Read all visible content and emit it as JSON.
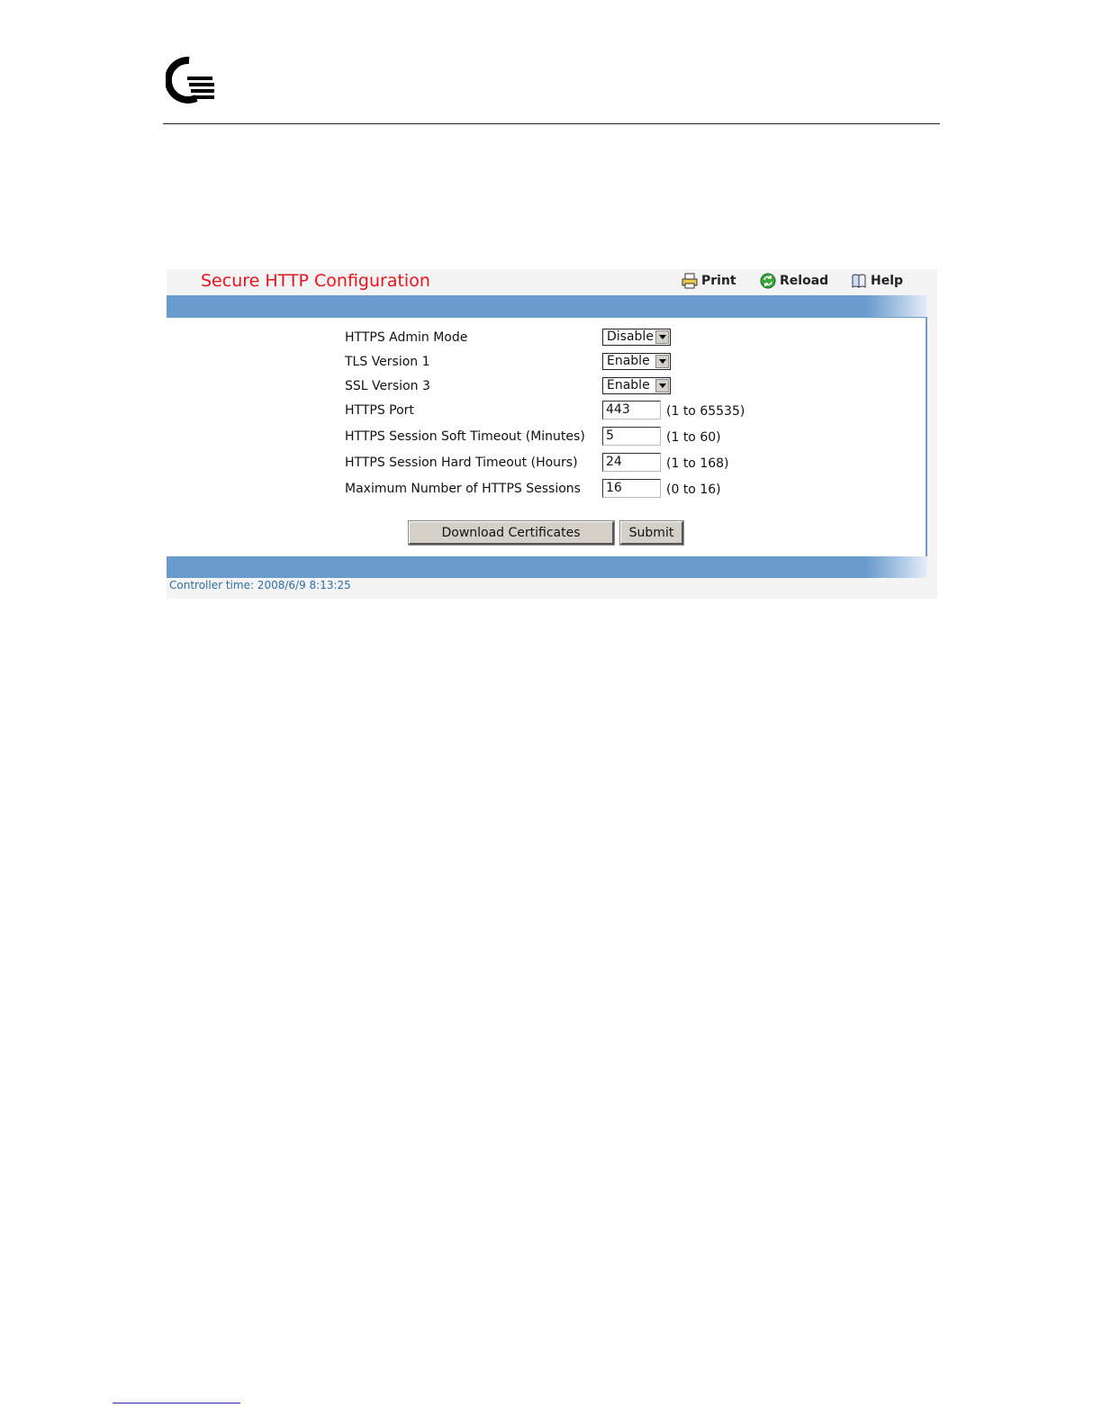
{
  "panel": {
    "title": "Secure HTTP Configuration",
    "toolbar": {
      "print_label": "Print",
      "reload_label": "Reload",
      "help_label": "Help",
      "icons": [
        "printer-icon",
        "reload-icon",
        "help-book-icon"
      ]
    }
  },
  "form": {
    "https_admin_mode": {
      "label": "HTTPS Admin Mode",
      "value": "Disable"
    },
    "tls_version_1": {
      "label": "TLS Version 1",
      "value": "Enable"
    },
    "ssl_version_3": {
      "label": "SSL Version 3",
      "value": "Enable"
    },
    "https_port": {
      "label": "HTTPS Port",
      "value": "443",
      "range": "(1 to 65535)"
    },
    "soft_timeout": {
      "label": "HTTPS Session Soft Timeout (Minutes)",
      "value": "5",
      "range": "(1 to 60)"
    },
    "hard_timeout": {
      "label": "HTTPS Session Hard Timeout (Hours)",
      "value": "24",
      "range": "(1 to 168)"
    },
    "max_sessions": {
      "label": "Maximum Number of HTTPS Sessions",
      "value": "16",
      "range": "(0 to 16)"
    }
  },
  "buttons": {
    "download_label": "Download Certificates",
    "submit_label": "Submit"
  },
  "footer": {
    "controller_time": "Controller time: 2008/6/9 8:13:25"
  },
  "colors": {
    "title": "#e8131b",
    "bar": "#6a9bcd",
    "footer_text": "#2a6fa8"
  }
}
